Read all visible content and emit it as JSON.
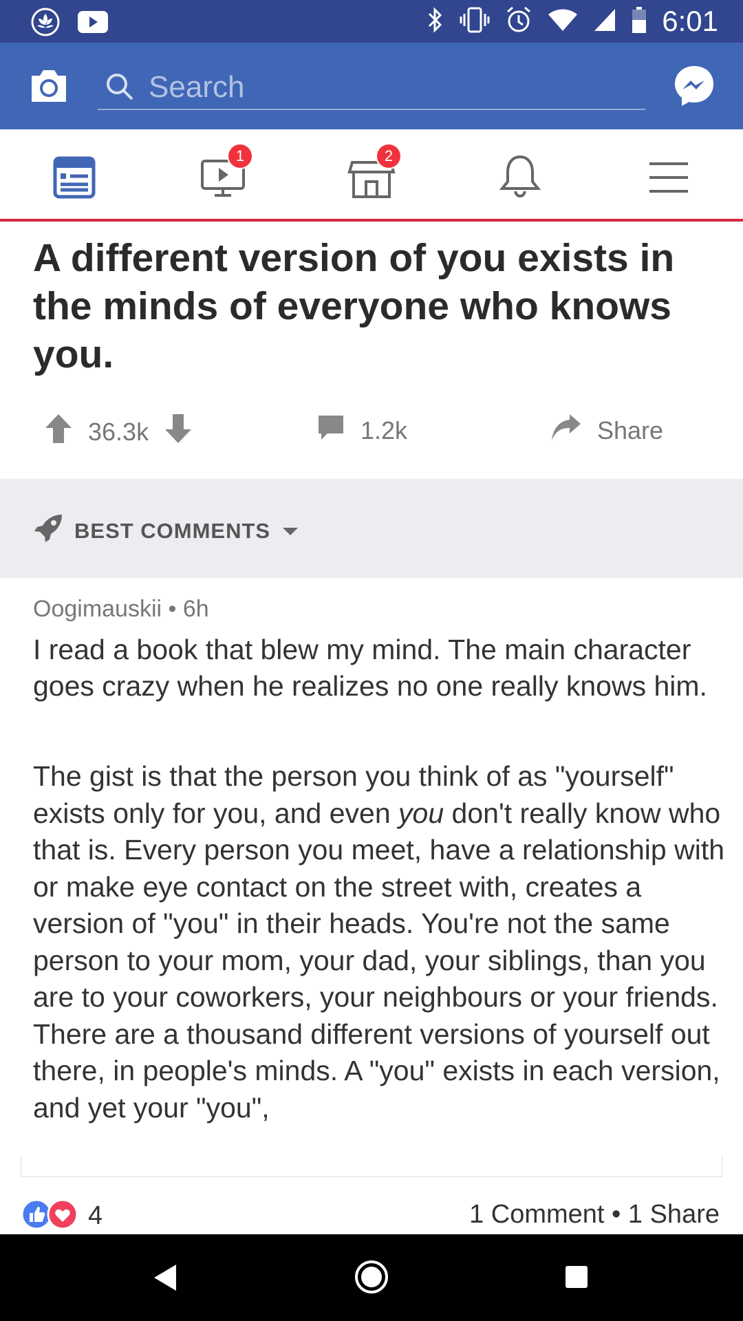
{
  "status_bar": {
    "time": "6:01"
  },
  "header": {
    "search_placeholder": "Search"
  },
  "nav": {
    "tabs": [
      {
        "name": "news-feed",
        "badge": ""
      },
      {
        "name": "watch",
        "badge": "1"
      },
      {
        "name": "marketplace",
        "badge": "2"
      },
      {
        "name": "notifications",
        "badge": ""
      },
      {
        "name": "menu",
        "badge": ""
      }
    ],
    "active_color": "#4066b6"
  },
  "post": {
    "title": "A different version of you exists in the minds of everyone who knows you.",
    "upvotes": "36.3k",
    "comments": "1.2k",
    "share_label": "Share"
  },
  "comments_section": {
    "label": "BEST COMMENTS"
  },
  "comment": {
    "author": "Oogimauskii",
    "time": "6h",
    "separator": "•",
    "paragraph1": "I read a book that blew my mind. The main character goes crazy when he realizes no one really knows him.",
    "paragraph2_before": "The gist is that the person you think of as \"yourself\" exists only for you, and even ",
    "paragraph2_emphasis": "you",
    "paragraph2_after": " don't really know who that is. Every person you meet, have a relationship with or make eye contact on the street with, creates a version of \"you\" in their heads. You're not the same person to your mom, your dad, your siblings, than you are to your coworkers, your neighbours or your friends. There are a thousand different versions of yourself out there, in people's minds. A \"you\" exists in each version, and yet your \"you\","
  },
  "footer": {
    "reaction_count": "4",
    "stats": "1 Comment • 1 Share"
  },
  "colors": {
    "status_bar": "#31468f",
    "fb_blue": "#4066b6",
    "accent_red": "#d9283f",
    "badge_red": "#f0323c"
  }
}
